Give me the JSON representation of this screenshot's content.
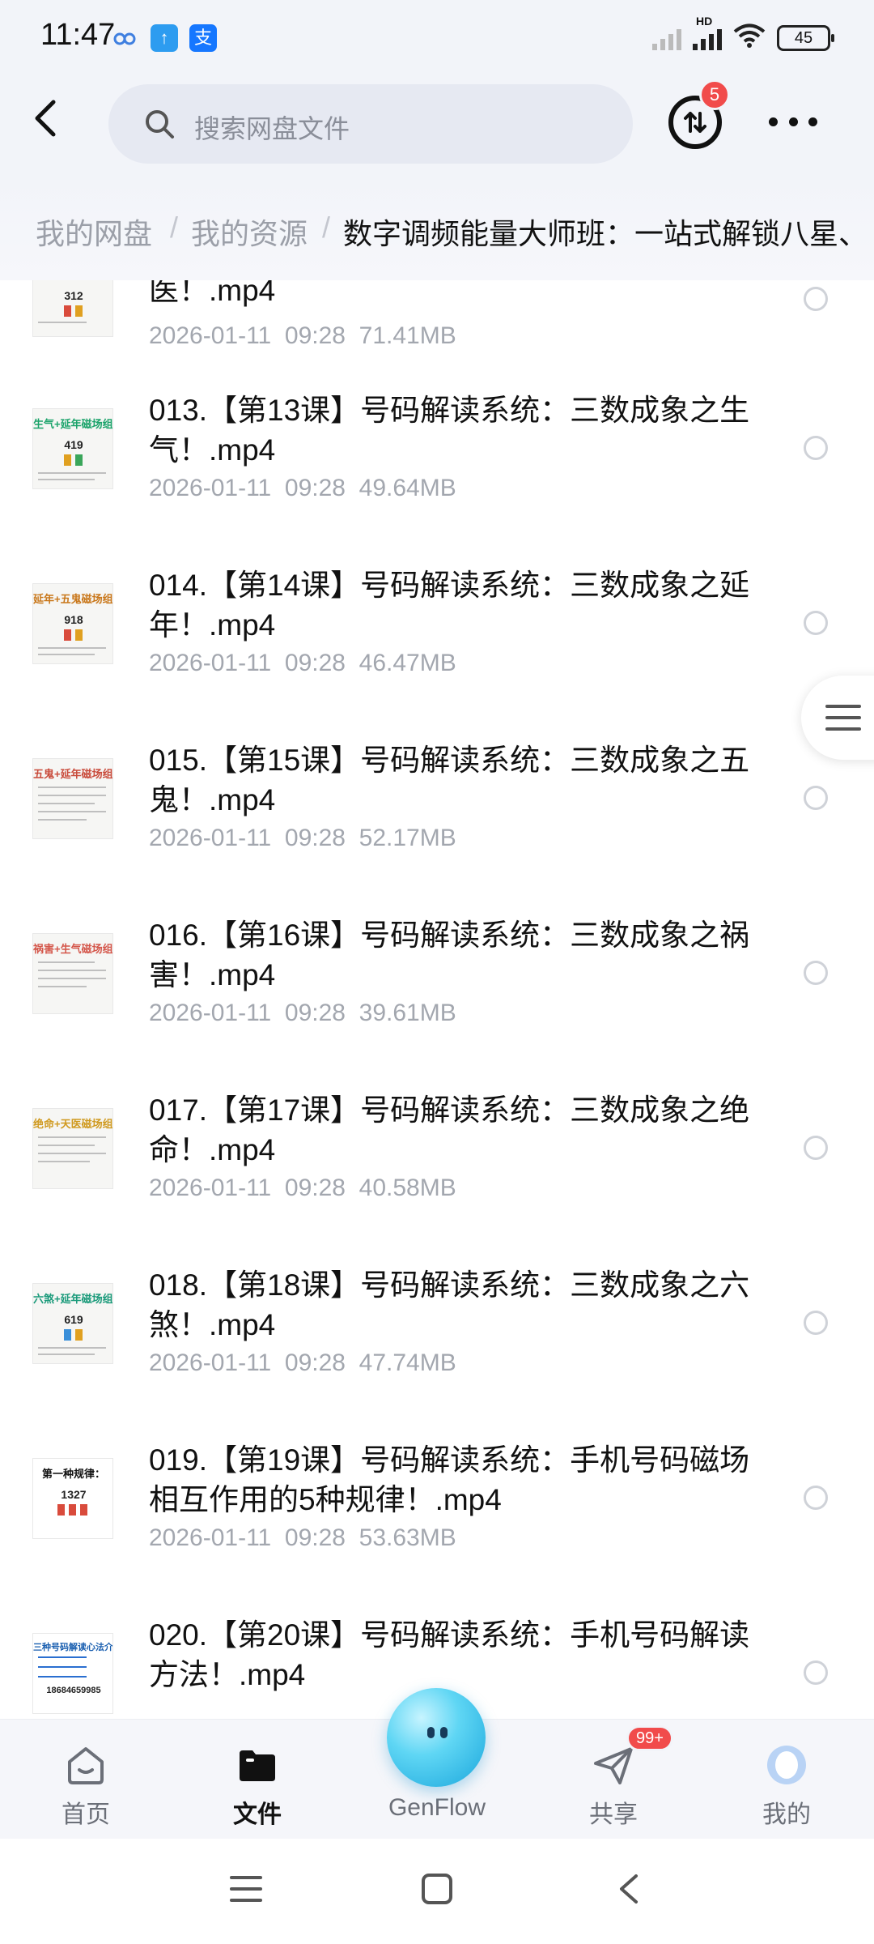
{
  "status_bar": {
    "time": "11:47",
    "battery": "45",
    "network_label": "HD",
    "icons": [
      "baidu-cloud-icon",
      "upload-app-icon",
      "alipay-icon",
      "signal-icon",
      "wifi-icon",
      "battery-icon"
    ]
  },
  "header": {
    "search_placeholder": "搜索网盘文件",
    "transfer_badge": "5"
  },
  "breadcrumb": {
    "root": "我的网盘",
    "level1": "我的资源",
    "current": "数字调频能量大师班：一站式解锁八星、",
    "separator": "/"
  },
  "files": [
    {
      "name": "医！.mp4",
      "date": "2026-01-11",
      "time": "09:28",
      "size": "71.41MB",
      "thumb_title": "",
      "thumb_number": "312"
    },
    {
      "name": "013.【第13课】号码解读系统：三数成象之生气！.mp4",
      "date": "2026-01-11",
      "time": "09:28",
      "size": "49.64MB",
      "thumb_title": "生气+延年磁场组合",
      "thumb_number": "419"
    },
    {
      "name": "014.【第14课】号码解读系统：三数成象之延年！.mp4",
      "date": "2026-01-11",
      "time": "09:28",
      "size": "46.47MB",
      "thumb_title": "延年+五鬼磁场组合",
      "thumb_number": "918"
    },
    {
      "name": "015.【第15课】号码解读系统：三数成象之五鬼！.mp4",
      "date": "2026-01-11",
      "time": "09:28",
      "size": "52.17MB",
      "thumb_title": "五鬼+延年磁场组合",
      "thumb_number": ""
    },
    {
      "name": "016.【第16课】号码解读系统：三数成象之祸害！.mp4",
      "date": "2026-01-11",
      "time": "09:28",
      "size": "39.61MB",
      "thumb_title": "祸害+生气磁场组合",
      "thumb_number": ""
    },
    {
      "name": "017.【第17课】号码解读系统：三数成象之绝命！.mp4",
      "date": "2026-01-11",
      "time": "09:28",
      "size": "40.58MB",
      "thumb_title": "绝命+天医磁场组合",
      "thumb_number": ""
    },
    {
      "name": "018.【第18课】号码解读系统：三数成象之六煞！.mp4",
      "date": "2026-01-11",
      "time": "09:28",
      "size": "47.74MB",
      "thumb_title": "六煞+延年磁场组合",
      "thumb_number": "619"
    },
    {
      "name": "019.【第19课】号码解读系统：手机号码磁场相互作用的5种规律！.mp4",
      "date": "2026-01-11",
      "time": "09:28",
      "size": "53.63MB",
      "thumb_title": "第一种规律：",
      "thumb_number": "1327"
    },
    {
      "name": "020.【第20课】号码解读系统：手机号码解读方法！.mp4",
      "date": "",
      "time": "",
      "size": "",
      "thumb_title": "三种号码解读心法介绍",
      "thumb_number": "18684659985"
    }
  ],
  "bottom_nav": {
    "home": "首页",
    "files": "文件",
    "genflow": "GenFlow",
    "share": "共享",
    "share_badge": "99+",
    "me": "我的",
    "active": "files"
  },
  "colors": {
    "accent_blue": "#1aa6dc",
    "badge_red": "#f14b4b",
    "muted_text": "#a3a7af",
    "header_bg": "#f2f4f9"
  }
}
